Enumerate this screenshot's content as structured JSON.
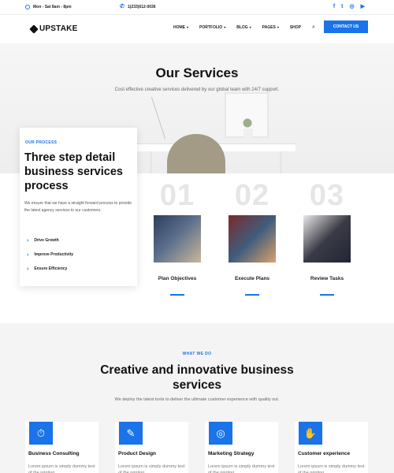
{
  "topbar": {
    "hours": "Mon - Sat 8am - 8pm",
    "phone": "1(233)612-0036",
    "social": [
      {
        "icon": "facebook-icon",
        "glyph": "f"
      },
      {
        "icon": "twitter-icon",
        "glyph": "t"
      },
      {
        "icon": "instagram-icon",
        "glyph": "◎"
      },
      {
        "icon": "youtube-icon",
        "glyph": "▶"
      }
    ]
  },
  "nav": {
    "logo": "UPSTAKE",
    "items": [
      "HOME",
      "PORTFOLIO",
      "BLOG",
      "PAGES",
      "SHOP"
    ],
    "contact_button": "CONTACT US"
  },
  "hero": {
    "title": "Our Services",
    "subtitle": "Cost effective creative services delivered by our global team with 24/7 support."
  },
  "process": {
    "label": "OUR PROCESS",
    "title": "Three step detail business services process",
    "description": "We ensure that we have a straight forward process to provide the latest agency services to our customers.",
    "items": [
      "Drive Growth",
      "Improve Productivity",
      "Ensure Efficiency"
    ]
  },
  "steps": [
    {
      "number": "01",
      "label": "Plan Objectives"
    },
    {
      "number": "02",
      "label": "Execute Plans"
    },
    {
      "number": "03",
      "label": "Review Tasks"
    }
  ],
  "services": {
    "label": "WHAT WE DO",
    "title": "Creative and innovative business services",
    "subtitle": "We deploy the latest tools to deliver the ultimate customer experience with quality out.",
    "cards": [
      {
        "title": "Business Consulting",
        "icon": "briefcase-clock-icon",
        "glyph": "⏱",
        "text": "Lorem ipsum is simply dummy text of the printing"
      },
      {
        "title": "Product Design",
        "icon": "design-tools-icon",
        "glyph": "✎",
        "text": "Lorem ipsum is simply dummy text of the printing"
      },
      {
        "title": "Marketing Strategy",
        "icon": "target-icon",
        "glyph": "◎",
        "text": "Lorem ipsum is simply dummy text of the printing"
      },
      {
        "title": "Customer experience",
        "icon": "handshake-icon",
        "glyph": "✋",
        "text": "Lorem ipsum is simply dummy text of the printing"
      }
    ]
  },
  "colors": {
    "accent": "#1a73e8",
    "section_bg": "#f4f4f4"
  }
}
